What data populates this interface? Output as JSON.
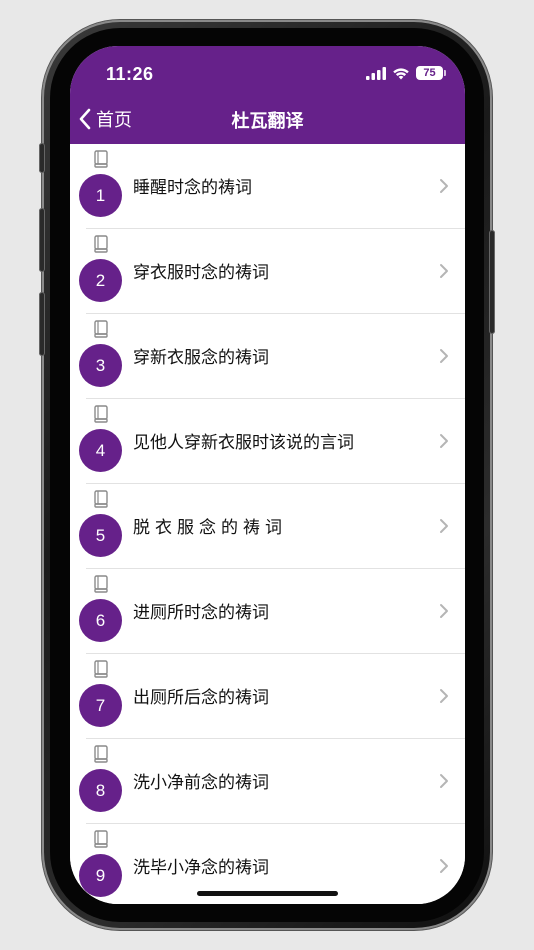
{
  "status_bar": {
    "time": "11:26",
    "battery": "75",
    "icons": [
      "signal-icon",
      "wifi-icon",
      "battery-icon"
    ]
  },
  "nav": {
    "back_label": "首页",
    "title": "杜瓦翻译"
  },
  "items": [
    {
      "number": "1",
      "title": "睡醒时念的祷词"
    },
    {
      "number": "2",
      "title": "穿衣服时念的祷词"
    },
    {
      "number": "3",
      "title": "穿新衣服念的祷词"
    },
    {
      "number": "4",
      "title": "见他人穿新衣服时该说的言词"
    },
    {
      "number": "5",
      "title": "脱衣服念的祷词"
    },
    {
      "number": "6",
      "title": "进厕所时念的祷词"
    },
    {
      "number": "7",
      "title": "出厕所后念的祷词"
    },
    {
      "number": "8",
      "title": "洗小净前念的祷词"
    },
    {
      "number": "9",
      "title": "洗毕小净念的祷词"
    }
  ],
  "colors": {
    "accent": "#66218a",
    "background": "#ffffff",
    "page": "#e8e8e8"
  }
}
